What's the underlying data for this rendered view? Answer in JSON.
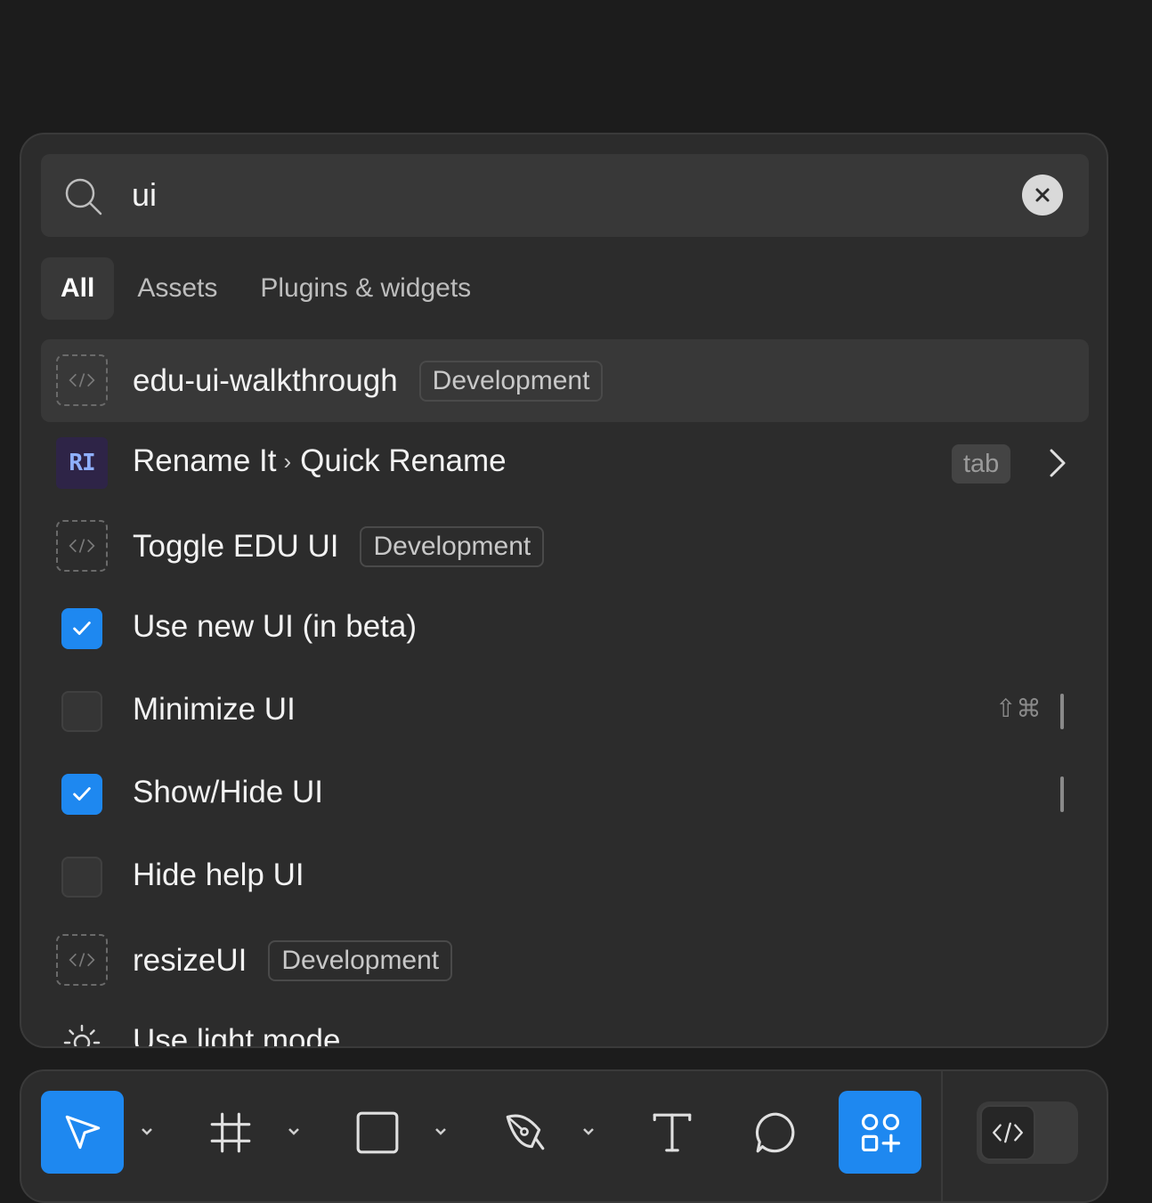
{
  "search": {
    "value": "ui",
    "placeholder": ""
  },
  "tabs": [
    {
      "label": "All",
      "active": true
    },
    {
      "label": "Assets",
      "active": false
    },
    {
      "label": "Plugins & widgets",
      "active": false
    }
  ],
  "results": [
    {
      "kind": "plugin",
      "label": "edu-ui-walkthrough",
      "badge": "Development",
      "highlighted": true
    },
    {
      "kind": "plugin-ri",
      "icon_text": "RI",
      "label": "Rename It",
      "sublabel": "Quick Rename",
      "shortcut_chip": "tab"
    },
    {
      "kind": "plugin",
      "label": "Toggle EDU UI",
      "badge": "Development"
    },
    {
      "kind": "checkbox",
      "label": "Use new UI (in beta)",
      "checked": true
    },
    {
      "kind": "checkbox",
      "label": "Minimize UI",
      "checked": false,
      "shortcut": "⇧⌘"
    },
    {
      "kind": "checkbox",
      "label": "Show/Hide UI",
      "checked": true
    },
    {
      "kind": "checkbox",
      "label": "Hide help UI",
      "checked": false
    },
    {
      "kind": "plugin",
      "label": "resizeUI",
      "badge": "Development"
    },
    {
      "kind": "action",
      "label": "Use light mode"
    }
  ],
  "toolbar": {
    "tools": [
      "move-tool",
      "frame-tool",
      "shape-tool",
      "pen-tool",
      "text-tool",
      "comment-tool",
      "actions-tool"
    ],
    "active_tool": "move-tool",
    "accent_color": "#1e88f0"
  }
}
